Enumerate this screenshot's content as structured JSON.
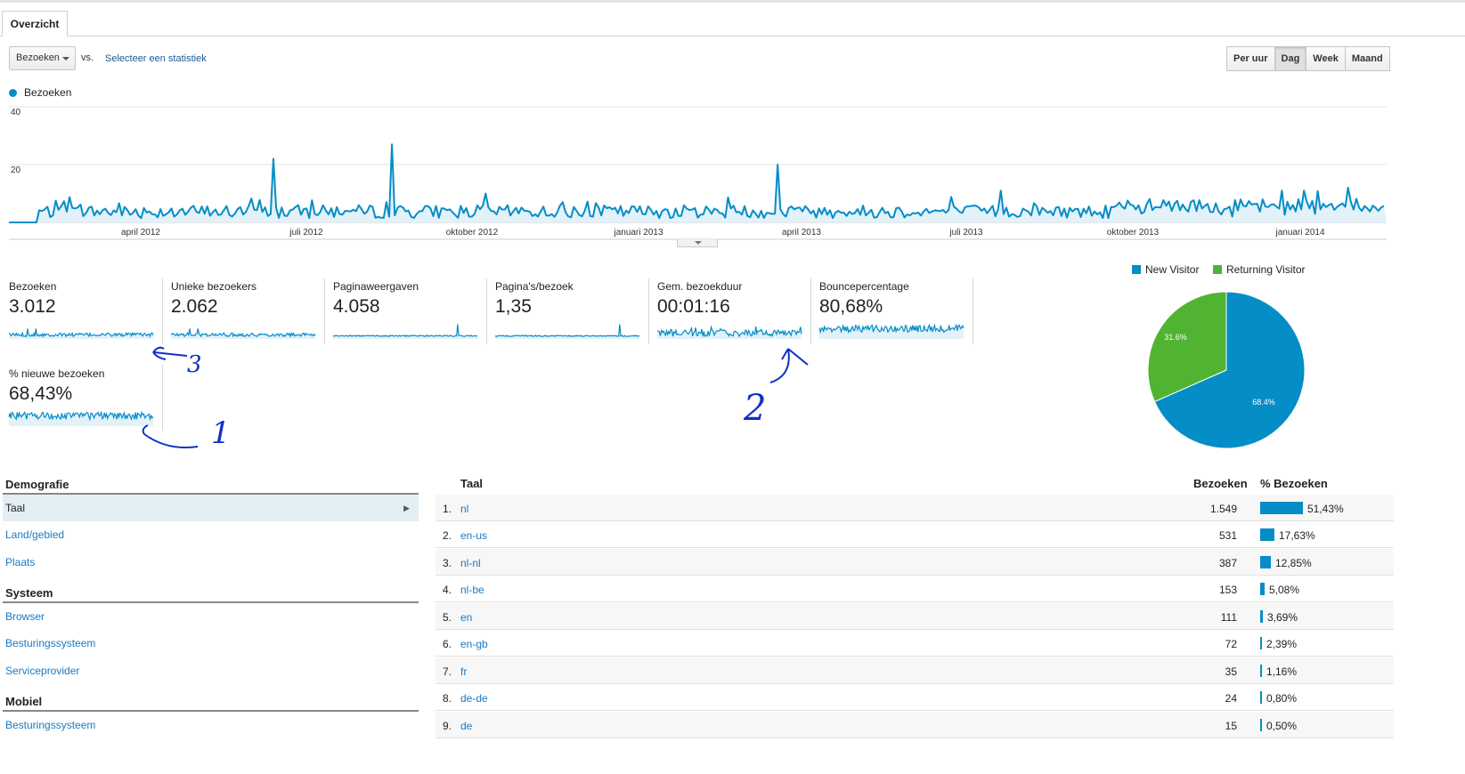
{
  "tabs": {
    "overview": "Overzicht"
  },
  "controls": {
    "metric_select": "Bezoeken",
    "vs": "vs.",
    "select_stat": "Selecteer een statistiek",
    "periods": [
      "Per uur",
      "Dag",
      "Week",
      "Maand"
    ],
    "active_period": "Dag"
  },
  "main_chart": {
    "series_name": "Bezoeken",
    "y_ticks": [
      "40",
      "20"
    ],
    "x_labels": [
      "april 2012",
      "juli 2012",
      "oktober 2012",
      "januari 2013",
      "april 2013",
      "juli 2013",
      "oktober 2013",
      "januari 2014"
    ],
    "color": "#058dc7"
  },
  "metrics": [
    {
      "label": "Bezoeken",
      "value": "3.012"
    },
    {
      "label": "Unieke bezoekers",
      "value": "2.062"
    },
    {
      "label": "Paginaweergaven",
      "value": "4.058"
    },
    {
      "label": "Pagina's/bezoek",
      "value": "1,35"
    },
    {
      "label": "Gem. bezoekduur",
      "value": "00:01:16"
    },
    {
      "label": "Bouncepercentage",
      "value": "80,68%"
    },
    {
      "label": "% nieuwe bezoeken",
      "value": "68,43%"
    }
  ],
  "pie": {
    "legend": [
      {
        "label": "New Visitor",
        "color": "#058dc7"
      },
      {
        "label": "Returning Visitor",
        "color": "#50b432"
      }
    ],
    "new_pct_label": "68.4%",
    "returning_pct_label": "31.6%",
    "new_fraction": 0.684
  },
  "nav": {
    "demografie": "Demografie",
    "demografie_items": [
      "Taal",
      "Land/gebied",
      "Plaats"
    ],
    "systeem": "Systeem",
    "systeem_items": [
      "Browser",
      "Besturingssysteem",
      "Serviceprovider"
    ],
    "mobiel": "Mobiel",
    "mobiel_items": [
      "Besturingssysteem"
    ]
  },
  "table": {
    "col_taal": "Taal",
    "col_bezoeken": "Bezoeken",
    "col_pct": "% Bezoeken",
    "rows": [
      {
        "idx": "1.",
        "lang": "nl",
        "count": "1.549",
        "pct": "51,43%",
        "frac": 0.5143
      },
      {
        "idx": "2.",
        "lang": "en-us",
        "count": "531",
        "pct": "17,63%",
        "frac": 0.1763
      },
      {
        "idx": "3.",
        "lang": "nl-nl",
        "count": "387",
        "pct": "12,85%",
        "frac": 0.1285
      },
      {
        "idx": "4.",
        "lang": "nl-be",
        "count": "153",
        "pct": "5,08%",
        "frac": 0.0508
      },
      {
        "idx": "5.",
        "lang": "en",
        "count": "111",
        "pct": "3,69%",
        "frac": 0.0369
      },
      {
        "idx": "6.",
        "lang": "en-gb",
        "count": "72",
        "pct": "2,39%",
        "frac": 0.0239
      },
      {
        "idx": "7.",
        "lang": "fr",
        "count": "35",
        "pct": "1,16%",
        "frac": 0.0116
      },
      {
        "idx": "8.",
        "lang": "de-de",
        "count": "24",
        "pct": "0,80%",
        "frac": 0.008
      },
      {
        "idx": "9.",
        "lang": "de",
        "count": "15",
        "pct": "0,50%",
        "frac": 0.005
      }
    ]
  },
  "annotations": [
    "3",
    "2",
    "1"
  ]
}
